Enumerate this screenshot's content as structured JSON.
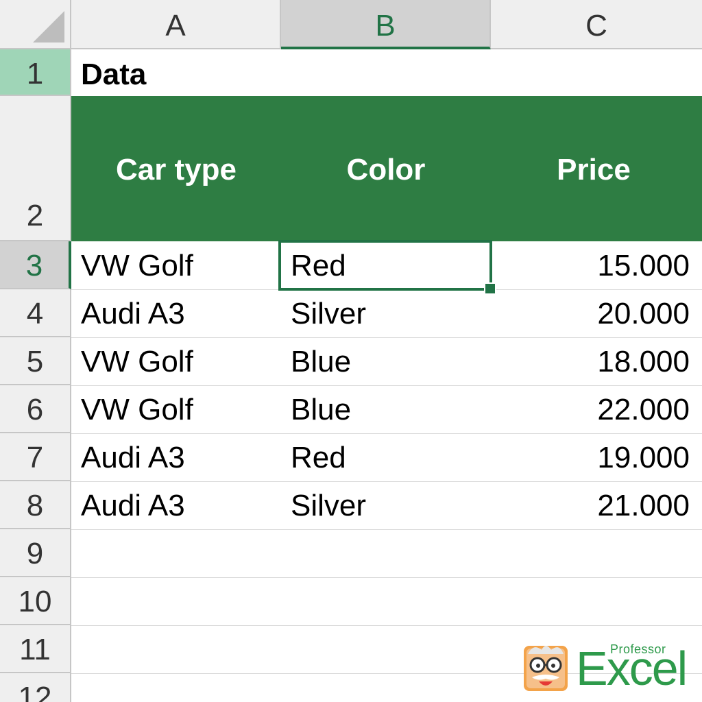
{
  "columns": [
    "A",
    "B",
    "C"
  ],
  "rows": [
    "1",
    "2",
    "3",
    "4",
    "5",
    "6",
    "7",
    "8",
    "9",
    "10",
    "11",
    "12"
  ],
  "title": "Data",
  "table": {
    "headers": [
      "Car type",
      "Color",
      "Price"
    ],
    "rows": [
      [
        "VW Golf",
        "Red",
        "15.000"
      ],
      [
        "Audi A3",
        "Silver",
        "20.000"
      ],
      [
        "VW Golf",
        "Blue",
        "18.000"
      ],
      [
        "VW Golf",
        "Blue",
        "22.000"
      ],
      [
        "Audi A3",
        "Red",
        "19.000"
      ],
      [
        "Audi A3",
        "Silver",
        "21.000"
      ]
    ]
  },
  "selection": {
    "active_cell": "B3"
  },
  "logo": {
    "top": "Professor",
    "word": "Excel"
  },
  "colors": {
    "accent": "#217346",
    "header_band": "#2e7d43",
    "row_highlight": "#9fd5b7",
    "logo_green": "#2e9a4b"
  }
}
